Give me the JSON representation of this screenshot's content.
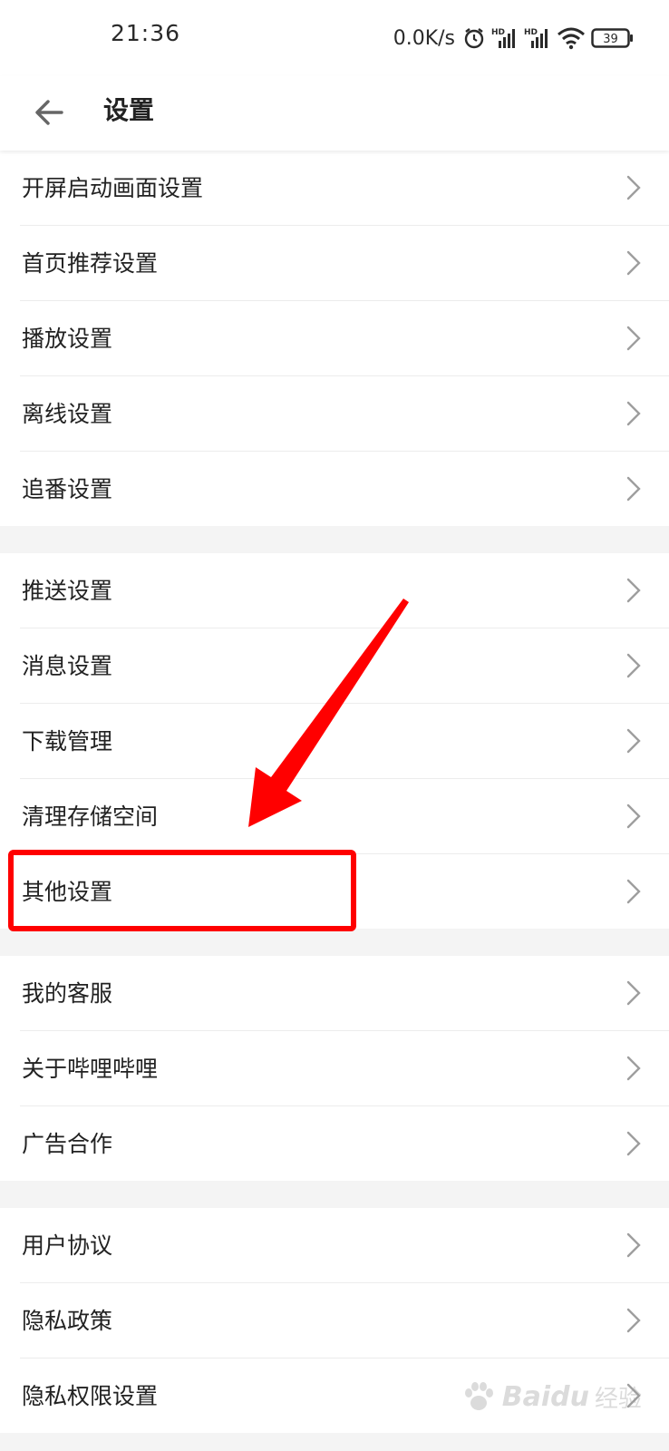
{
  "status_bar": {
    "time": "21:36",
    "net_speed": "0.0K/s",
    "battery": "39",
    "icons": [
      "alarm-icon",
      "hd-signal-icon",
      "hd-signal-icon",
      "wifi-icon",
      "battery-icon"
    ]
  },
  "header": {
    "title": "设置",
    "back_icon": "arrow-left-icon"
  },
  "groups": [
    {
      "items": [
        {
          "label": "开屏启动画面设置"
        },
        {
          "label": "首页推荐设置"
        },
        {
          "label": "播放设置"
        },
        {
          "label": "离线设置"
        },
        {
          "label": "追番设置"
        }
      ]
    },
    {
      "items": [
        {
          "label": "推送设置"
        },
        {
          "label": "消息设置"
        },
        {
          "label": "下载管理"
        },
        {
          "label": "清理存储空间"
        },
        {
          "label": "其他设置"
        }
      ]
    },
    {
      "items": [
        {
          "label": "我的客服"
        },
        {
          "label": "关于哔哩哔哩"
        },
        {
          "label": "广告合作"
        }
      ]
    },
    {
      "items": [
        {
          "label": "用户协议"
        },
        {
          "label": "隐私政策"
        },
        {
          "label": "隐私权限设置"
        }
      ]
    }
  ],
  "annotation": {
    "highlighted_item": "其他设置",
    "color": "#ff0000"
  },
  "watermark": {
    "brand": "Baidu",
    "sub": "经验"
  },
  "colors": {
    "background": "#f4f4f4",
    "surface": "#ffffff",
    "text": "#222222",
    "divider": "#ececec",
    "chevron": "#9e9e9e"
  }
}
